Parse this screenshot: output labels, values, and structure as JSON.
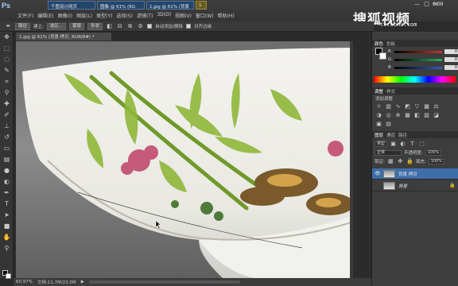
{
  "app": {
    "logo": "Ps",
    "menu": [
      "文件(F)",
      "编辑(E)",
      "图像(I)",
      "图层(L)",
      "类型(Y)",
      "选择(S)",
      "滤镜(T)",
      "3D(D)",
      "视图(V)",
      "窗口(W)",
      "帮助(H)"
    ],
    "task_tabs": [
      "千图设计网页",
      "图像 @ 61% (RG",
      "1.jpg @ 61% (背景",
      "1"
    ],
    "clock": "6:00",
    "window_controls": [
      "—",
      "□",
      "×"
    ]
  },
  "watermark": {
    "logo": "搜狐视频",
    "url": "tv.sohu.com"
  },
  "options_bar": {
    "tool_icon": "pen-icon",
    "mode_label": "路径",
    "make_selection_label": "选区...",
    "mask_label": "蒙版",
    "shape_label": "形状",
    "auto_add_delete_label": "自动添加/删除",
    "align_edges_label": "对齐边缘"
  },
  "tools": [
    "move-icon",
    "marquee-icon",
    "lasso-icon",
    "quick-select-icon",
    "crop-icon",
    "eyedropper-icon",
    "healing-icon",
    "brush-icon",
    "clone-stamp-icon",
    "history-brush-icon",
    "eraser-icon",
    "gradient-icon",
    "blur-icon",
    "dodge-icon",
    "pen-icon",
    "type-icon",
    "path-select-icon",
    "shape-icon",
    "hand-icon",
    "zoom-icon"
  ],
  "document": {
    "tab_label": "1.jpg @ 61% (背景 拷贝, RGB/8#) *",
    "zoom": "60.97%",
    "doc_info": "文档:11.7M/23.5M"
  },
  "color_panel": {
    "tabs": [
      "颜色",
      "色板"
    ],
    "channels": [
      {
        "letter": "R",
        "value": "0",
        "color": "#c0392b"
      },
      {
        "letter": "G",
        "value": "0",
        "color": "#27ae60"
      },
      {
        "letter": "B",
        "value": "0",
        "color": "#2e5fc0"
      }
    ]
  },
  "adjustments_panel": {
    "tabs": [
      "调整",
      "样式"
    ],
    "title": "添加调整",
    "icons": [
      "brightness-icon",
      "levels-icon",
      "curves-icon",
      "exposure-icon",
      "vibrance-icon",
      "hue-icon",
      "balance-icon",
      "bw-icon",
      "photo-filter-icon",
      "mixer-icon",
      "lookup-icon",
      "invert-icon",
      "posterize-icon",
      "threshold-icon",
      "selective-color-icon",
      "gradient-map-icon"
    ]
  },
  "layers_panel": {
    "tabs": [
      "图层",
      "通道",
      "路径"
    ],
    "kind_label": "类型",
    "blend_mode": "正常",
    "opacity_label": "不透明度:",
    "opacity_value": "100%",
    "lock_label": "锁定:",
    "fill_label": "填充:",
    "fill_value": "100%",
    "layers": [
      {
        "name": "背景 拷贝",
        "selected": true
      },
      {
        "name": "背景",
        "selected": false
      }
    ]
  }
}
